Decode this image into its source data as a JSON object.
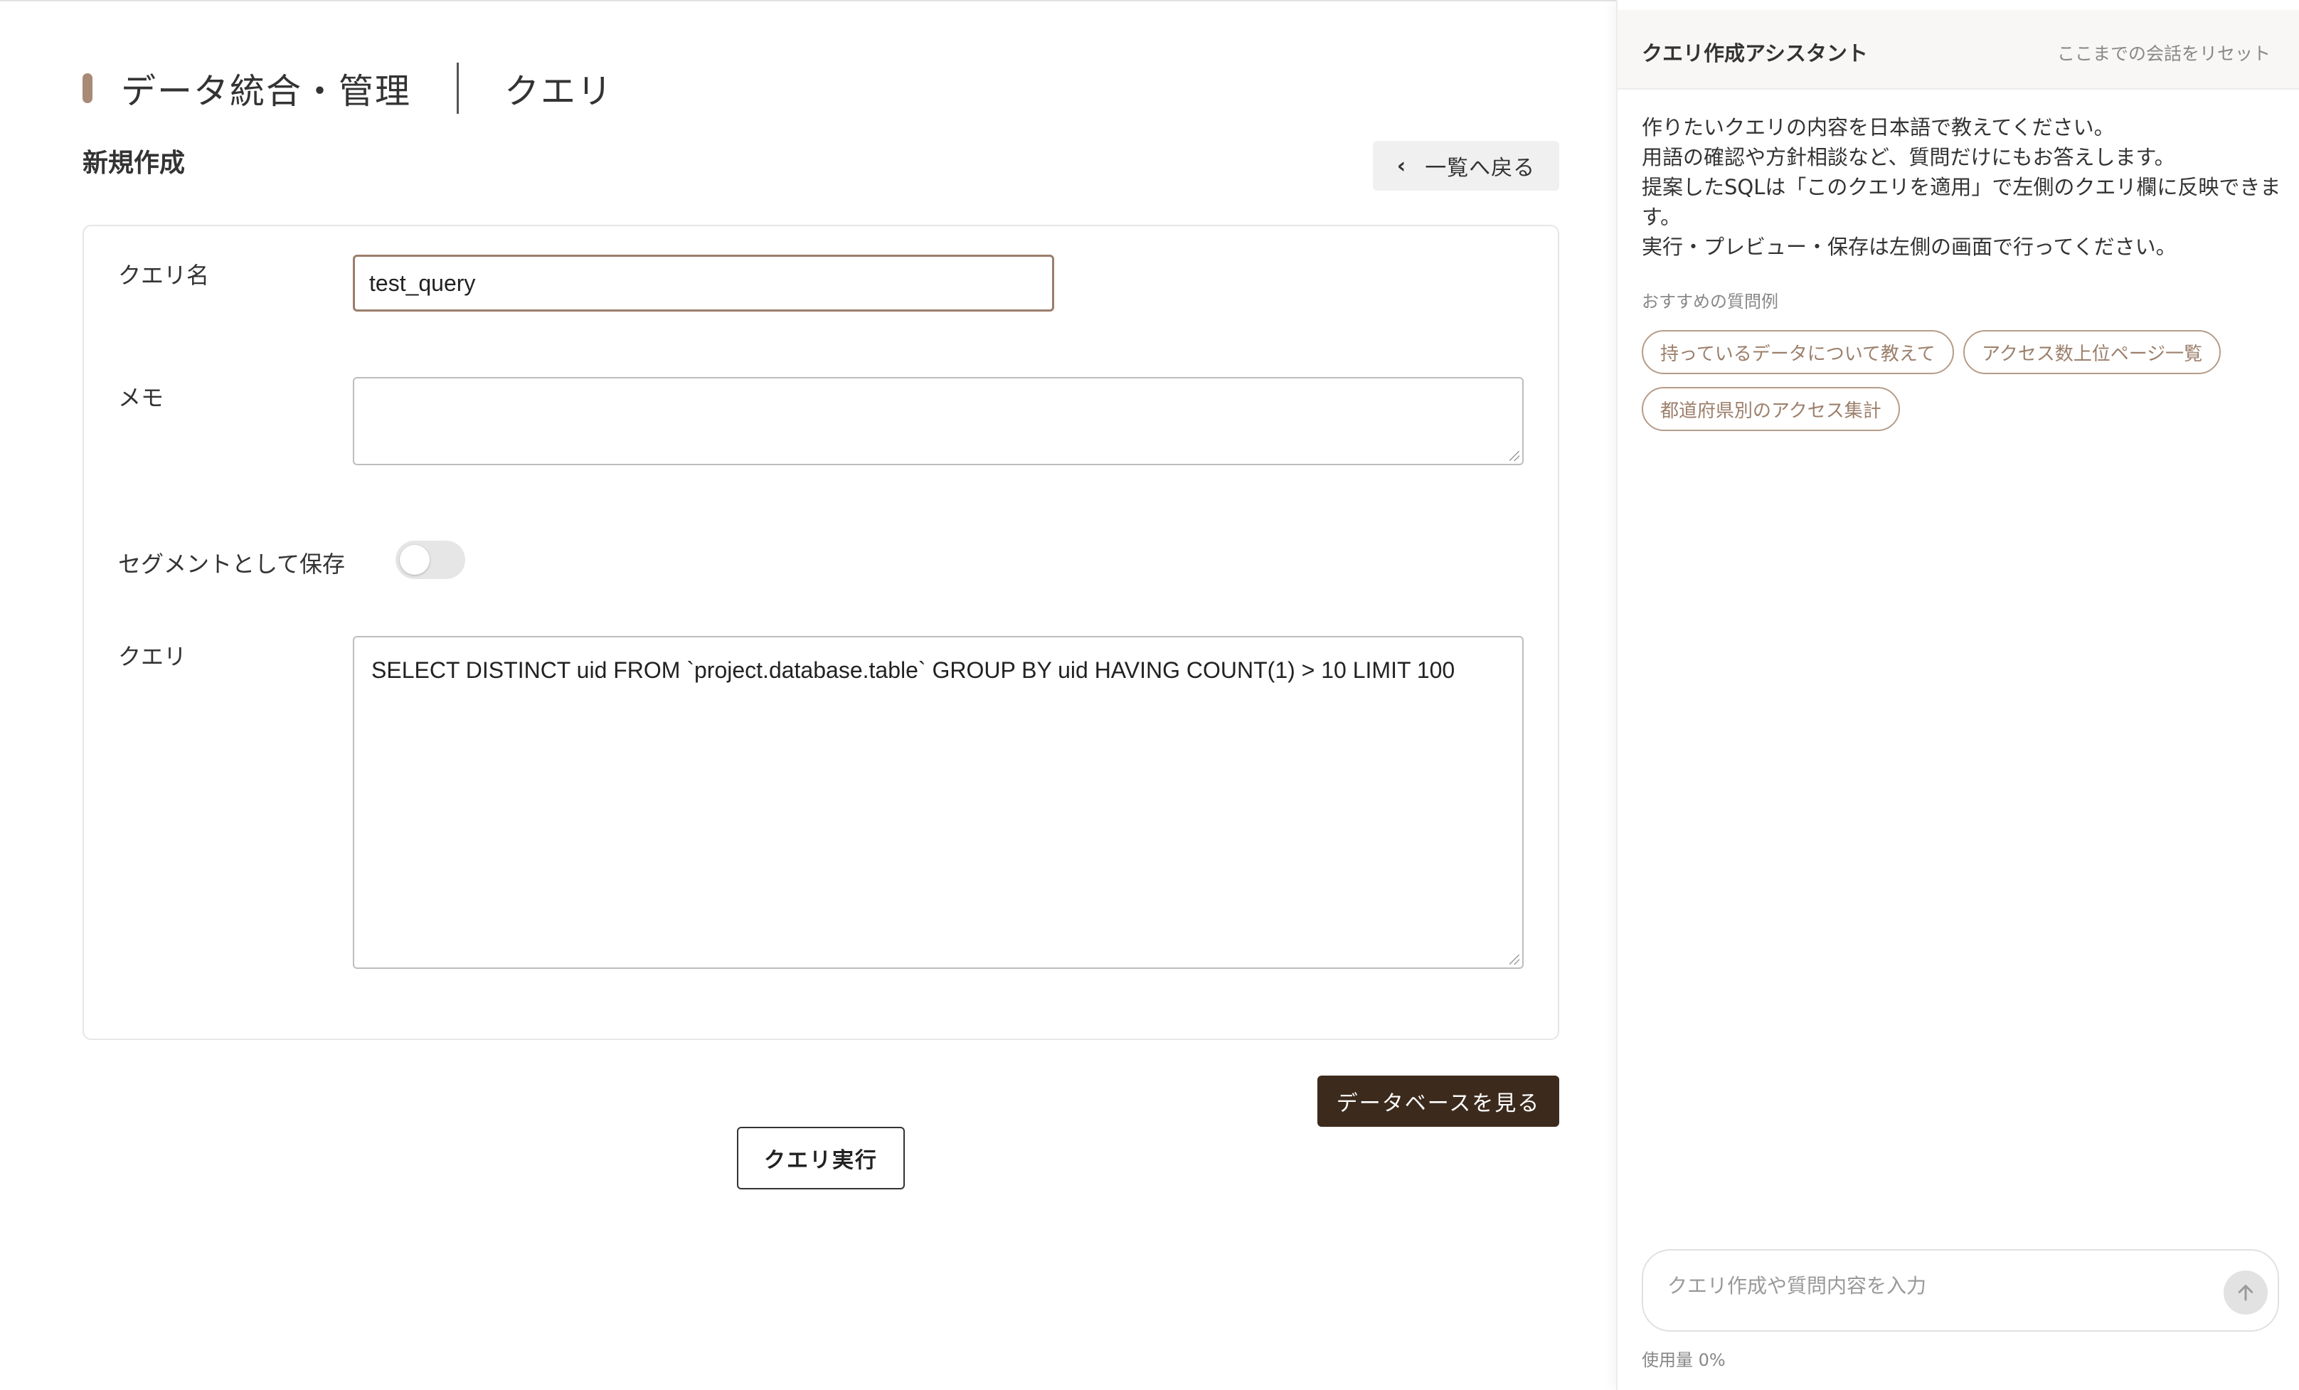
{
  "header": {
    "title": "データ統合・管理",
    "section": "クエリ",
    "subtitle": "新規作成",
    "back_label": "一覧へ戻る"
  },
  "form": {
    "name_label": "クエリ名",
    "name_value": "test_query",
    "memo_label": "メモ",
    "memo_value": "",
    "segment_label": "セグメントとして保存",
    "segment_enabled": false,
    "query_label": "クエリ",
    "query_value": "SELECT DISTINCT uid FROM `project.database.table` GROUP BY uid HAVING COUNT(1) > 10 LIMIT 100"
  },
  "actions": {
    "view_database": "データベースを見る",
    "run_query": "クエリ実行"
  },
  "assistant": {
    "title": "クエリ作成アシスタント",
    "reset_label": "ここまでの会話をリセット",
    "intro_lines": [
      "作りたいクエリの内容を日本語で教えてください。",
      "用語の確認や方針相談など、質問だけにもお答えします。",
      "提案したSQLは「このクエリを適用」で左側のクエリ欄に反映できま",
      "す。",
      "実行・プレビュー・保存は左側の画面で行ってください。"
    ],
    "examples_label": "おすすめの質問例",
    "examples": [
      "持っているデータについて教えて",
      "アクセス数上位ページ一覧",
      "都道府県別のアクセス集計"
    ],
    "input_placeholder": "クエリ作成や質問内容を入力",
    "usage": "使用量 0%"
  },
  "colors": {
    "accent": "#a88a76",
    "primary_button": "#3c2b1d",
    "chip_border": "#b69c89"
  }
}
